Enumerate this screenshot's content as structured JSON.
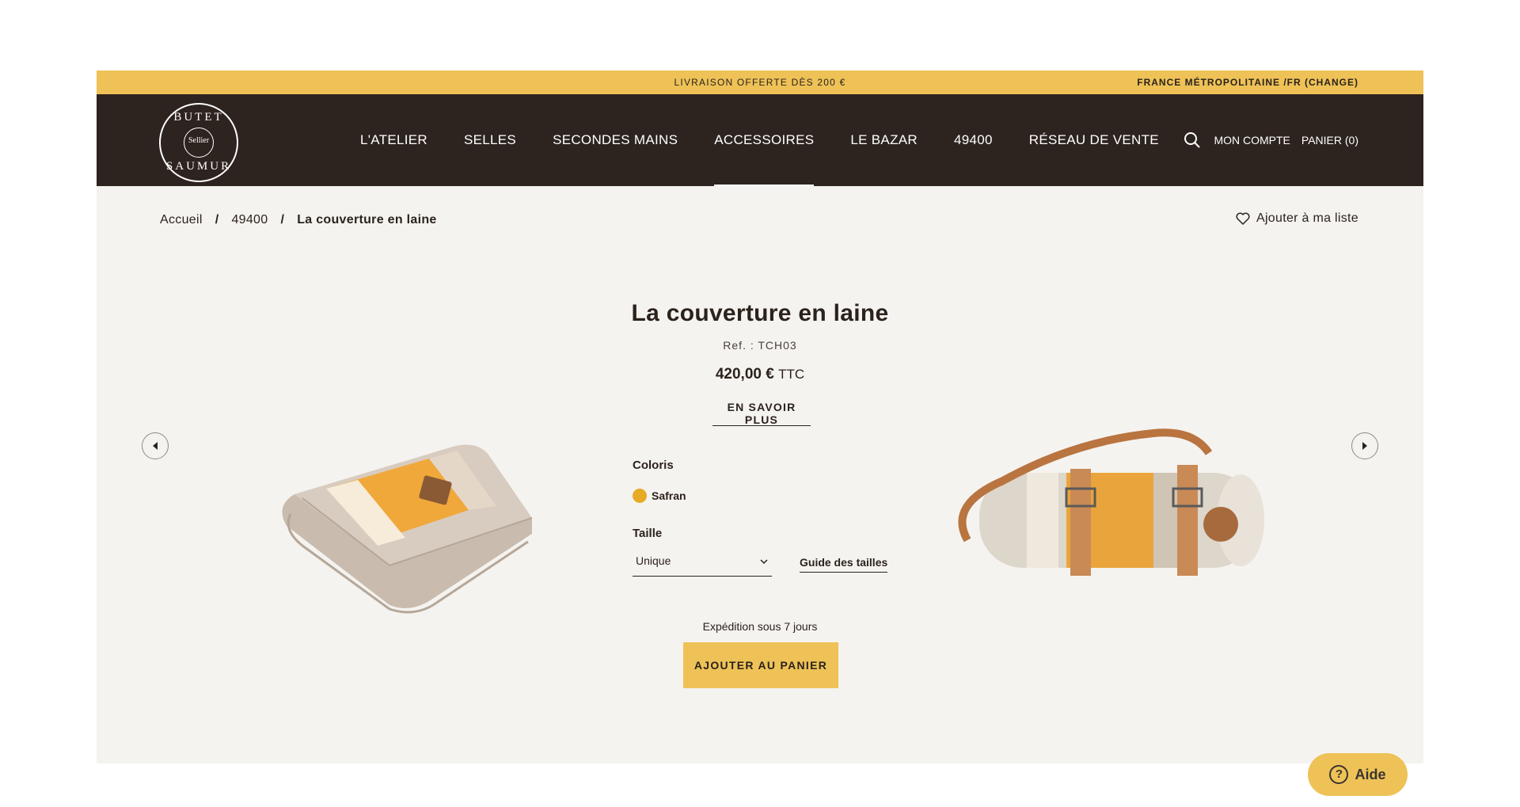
{
  "banner": {
    "promo": "LIVRAISON OFFERTE DÈS 200 €",
    "region": "FRANCE MÉTROPOLITAINE /FR (CHANGE)"
  },
  "header": {
    "logo": {
      "top": "BUTET",
      "mid": "Sellier",
      "bottom": "SAUMUR"
    },
    "nav": [
      {
        "label": "L'ATELIER"
      },
      {
        "label": "SELLES"
      },
      {
        "label": "SECONDES MAINS"
      },
      {
        "label": "ACCESSOIRES",
        "active": true
      },
      {
        "label": "LE BAZAR"
      },
      {
        "label": "49400"
      },
      {
        "label": "RÉSEAU DE VENTE"
      }
    ],
    "search_icon": "search-icon",
    "account": "MON COMPTE",
    "cart": "PANIER (0)"
  },
  "breadcrumb": {
    "items": [
      "Accueil",
      "49400"
    ],
    "current": "La couverture en laine",
    "separator": "/"
  },
  "wishlist": {
    "label": "Ajouter à ma liste",
    "icon": "heart-icon"
  },
  "product": {
    "title": "La couverture en laine",
    "ref": "Ref. : TCH03",
    "price": "420,00 €",
    "price_suffix": "TTC",
    "more": "EN SAVOIR PLUS",
    "coloris_label": "Coloris",
    "color": {
      "name": "Safran",
      "hex": "#e8a925"
    },
    "taille_label": "Taille",
    "size_value": "Unique",
    "size_guide": "Guide des tailles",
    "shipping": "Expédition sous 7 jours",
    "add_to_cart": "AJOUTER AU PANIER"
  },
  "carousel": {
    "prev_icon": "arrow-left-icon",
    "next_icon": "arrow-right-icon"
  },
  "help": {
    "label": "Aide",
    "icon": "question-icon"
  },
  "colors": {
    "accent": "#eec257",
    "header": "#2d231f",
    "background": "#f5f3f0",
    "text": "#2b221c"
  }
}
